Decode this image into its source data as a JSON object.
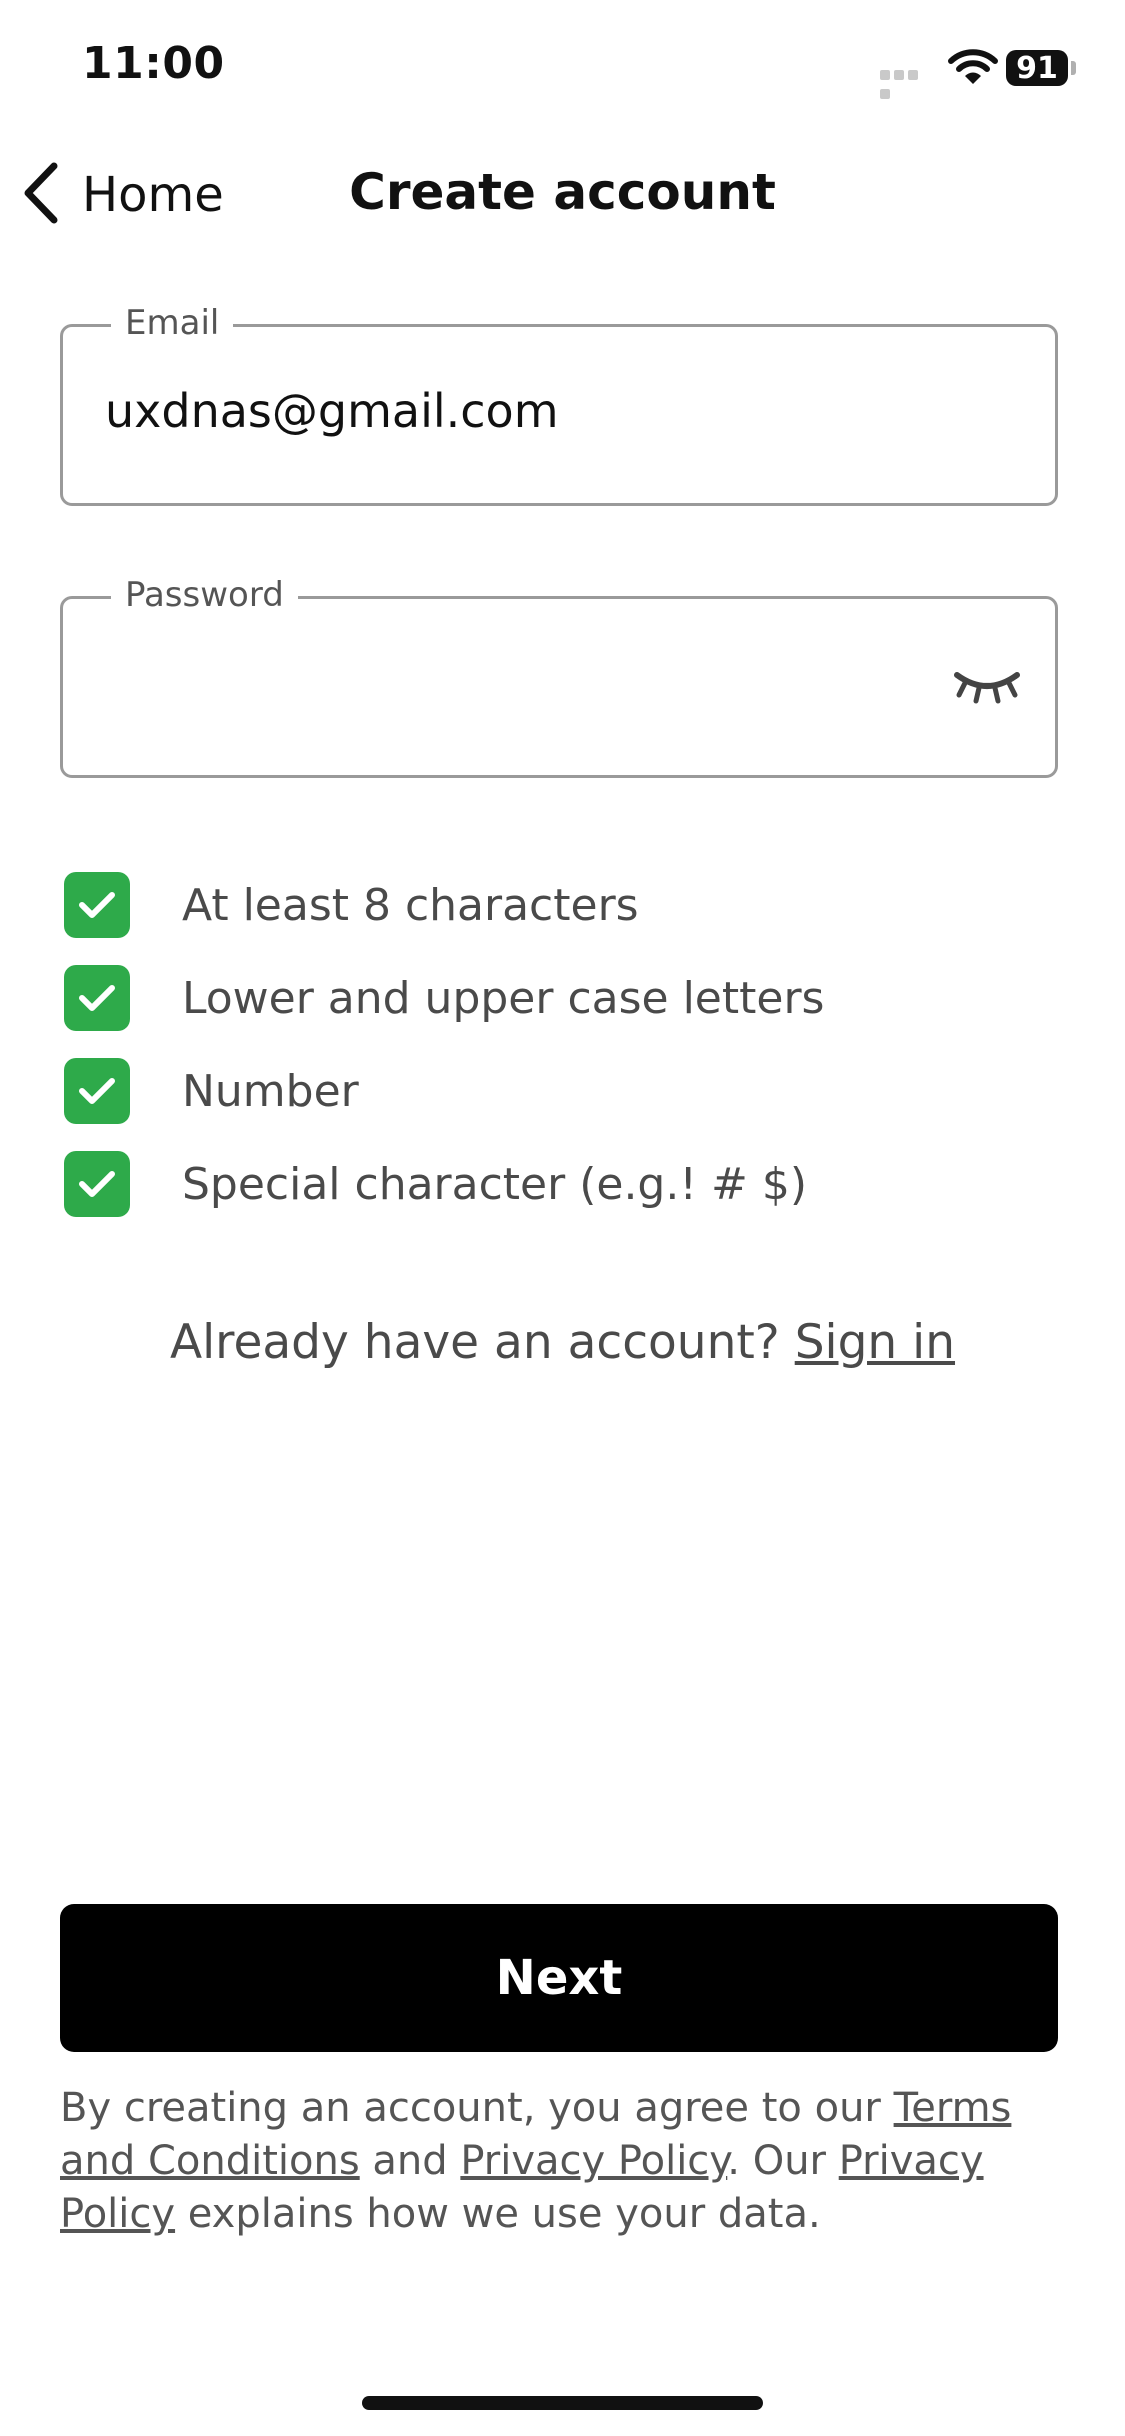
{
  "status_bar": {
    "time": "11:00",
    "battery": "91",
    "icons": [
      "signal-icon",
      "wifi-icon",
      "battery-icon"
    ]
  },
  "nav": {
    "back_label": "Home",
    "title": "Create account",
    "back_icon": "chevron-left-icon"
  },
  "form": {
    "email": {
      "label": "Email",
      "value": "uxdnas@gmail.com"
    },
    "password": {
      "label": "Password",
      "value": "",
      "toggle_icon": "eye-closed-icon"
    }
  },
  "requirements": [
    {
      "label": "At least 8 characters",
      "met": true
    },
    {
      "label": "Lower and upper case letters",
      "met": true
    },
    {
      "label": "Number",
      "met": true
    },
    {
      "label": "Special character (e.g.! # $)",
      "met": true
    }
  ],
  "signin": {
    "prompt": "Already have an account? ",
    "link": "Sign in"
  },
  "next_button": {
    "label": "Next"
  },
  "legal": {
    "part1": "By creating an account, you agree to our ",
    "terms_link": "Terms and Conditions",
    "part2": " and ",
    "privacy_link_1": "Privacy Policy",
    "part3": ". Our ",
    "privacy_link_2": "Privacy Policy",
    "part4": " explains how we use your data."
  },
  "colors": {
    "accent_green": "#2eaa4a",
    "primary_button": "#000000",
    "field_border": "#9a9a9a"
  }
}
